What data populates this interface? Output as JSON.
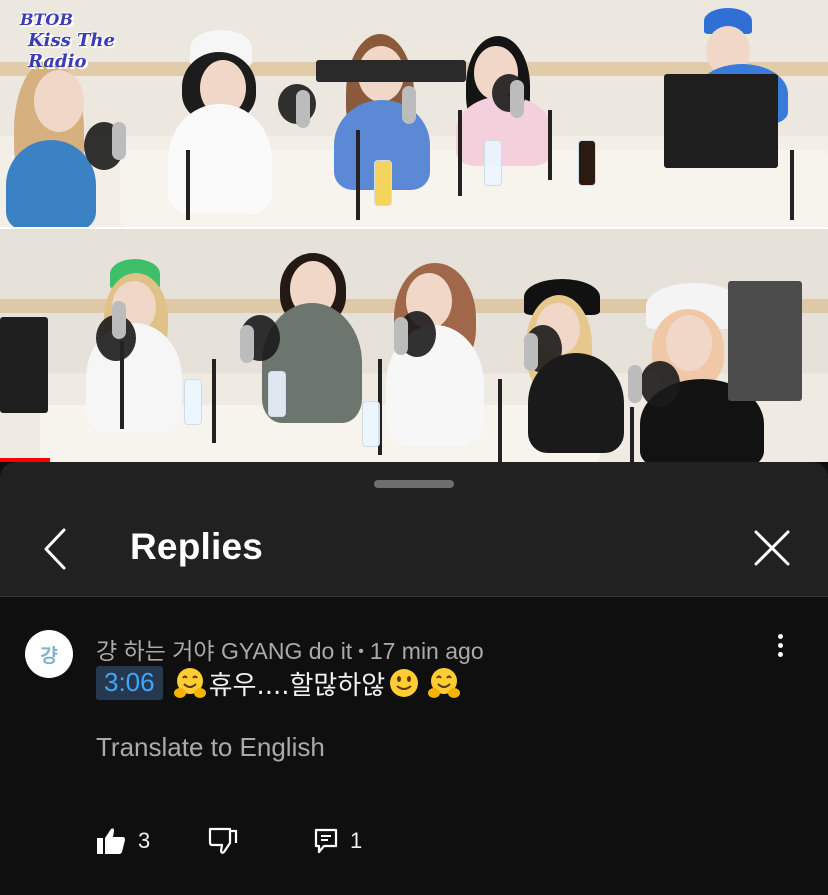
{
  "video": {
    "logo_line1": "BTOB",
    "logo_line2": "Kiss The Radio",
    "played_fraction": 0.06,
    "accent_red": "#ff0000"
  },
  "sheet": {
    "title": "Replies",
    "back_icon": "chevron-left-icon",
    "close_icon": "close-icon"
  },
  "comment": {
    "avatar_text": "걍",
    "author": "걍 하는 거야 GYANG do it",
    "separator": "•",
    "time_ago": "17 min ago",
    "timestamp": "3:06",
    "text": "휴우....할많하않",
    "emojis": [
      "hugging-face-emoji",
      "slightly-smiling-face-emoji",
      "hugging-face-emoji"
    ],
    "translate_label": "Translate to English",
    "likes": "3",
    "replies": "1",
    "timestamp_bg": "#263850",
    "timestamp_color": "#3ea6ff"
  }
}
